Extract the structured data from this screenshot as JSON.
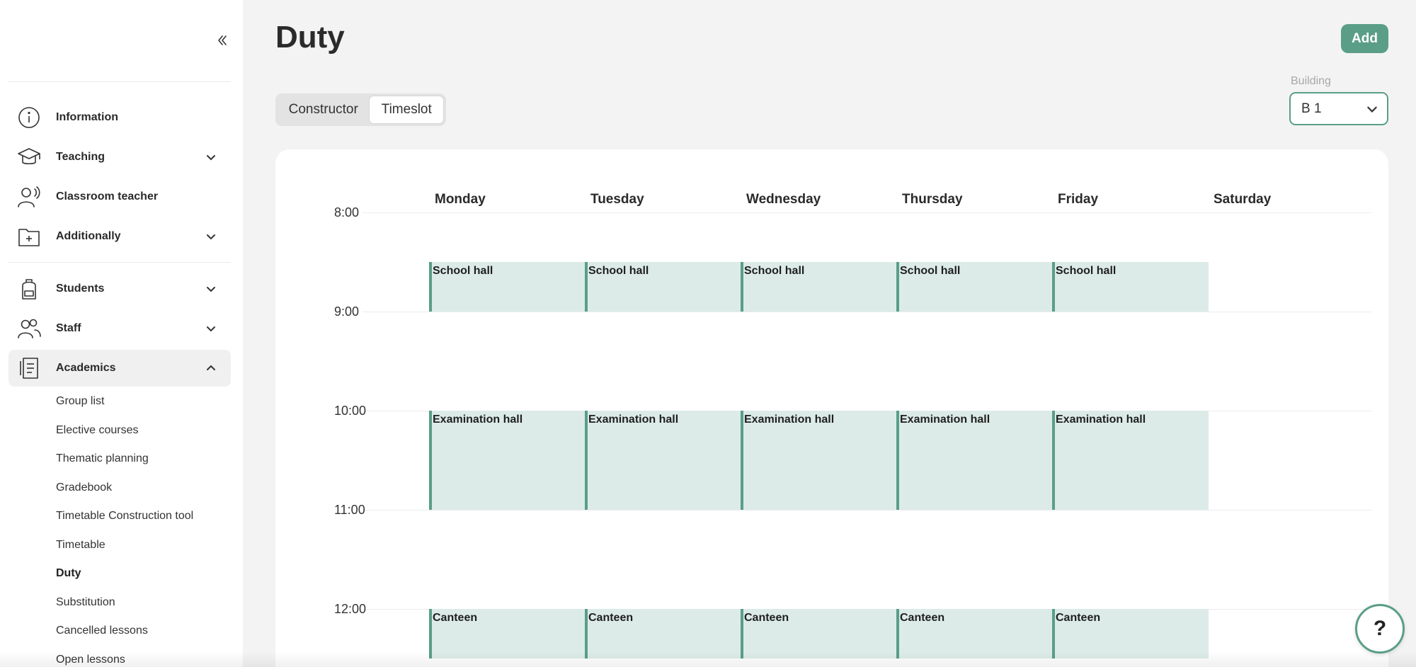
{
  "colors": {
    "accent": "#5a9e88",
    "event_bg": "#dcebe7",
    "page_bg": "#f3f3f3"
  },
  "sidebar": {
    "collapse_icon": "double-chevron-left-icon",
    "items": [
      {
        "label": "Information",
        "icon": "info-icon"
      },
      {
        "label": "Teaching",
        "icon": "graduation-cap-icon"
      },
      {
        "label": "Classroom teacher",
        "icon": "person-speaking-icon"
      },
      {
        "label": "Additionally",
        "icon": "folder-plus-icon"
      },
      {
        "label": "Students",
        "icon": "backpack-icon"
      },
      {
        "label": "Staff",
        "icon": "people-icon"
      },
      {
        "label": "Academics",
        "icon": "document-list-icon"
      }
    ],
    "academics_sub": [
      "Group list",
      "Elective courses",
      "Thematic planning",
      "Gradebook",
      "Timetable Construction tool",
      "Timetable",
      "Duty",
      "Substitution",
      "Cancelled lessons",
      "Open lessons"
    ]
  },
  "header": {
    "title": "Duty",
    "add_label": "Add"
  },
  "view_toggle": {
    "options": [
      "Constructor",
      "Timeslot"
    ],
    "selected": "Timeslot"
  },
  "building": {
    "label": "Building",
    "value": "B 1"
  },
  "calendar": {
    "days": [
      "Monday",
      "Tuesday",
      "Wednesday",
      "Thursday",
      "Friday",
      "Saturday"
    ],
    "times": [
      "8:00",
      "9:00",
      "10:00",
      "11:00",
      "12:00"
    ],
    "events": [
      {
        "label": "School hall",
        "start": "8:30",
        "end": "9:00",
        "days": [
          "Monday",
          "Tuesday",
          "Wednesday",
          "Thursday",
          "Friday"
        ]
      },
      {
        "label": "Examination hall",
        "start": "10:00",
        "end": "11:00",
        "days": [
          "Monday",
          "Tuesday",
          "Wednesday",
          "Thursday",
          "Friday"
        ]
      },
      {
        "label": "Canteen",
        "start": "12:00",
        "end": "12:30",
        "days": [
          "Monday",
          "Tuesday",
          "Wednesday",
          "Thursday",
          "Friday"
        ]
      }
    ]
  },
  "help": {
    "label": "?"
  }
}
